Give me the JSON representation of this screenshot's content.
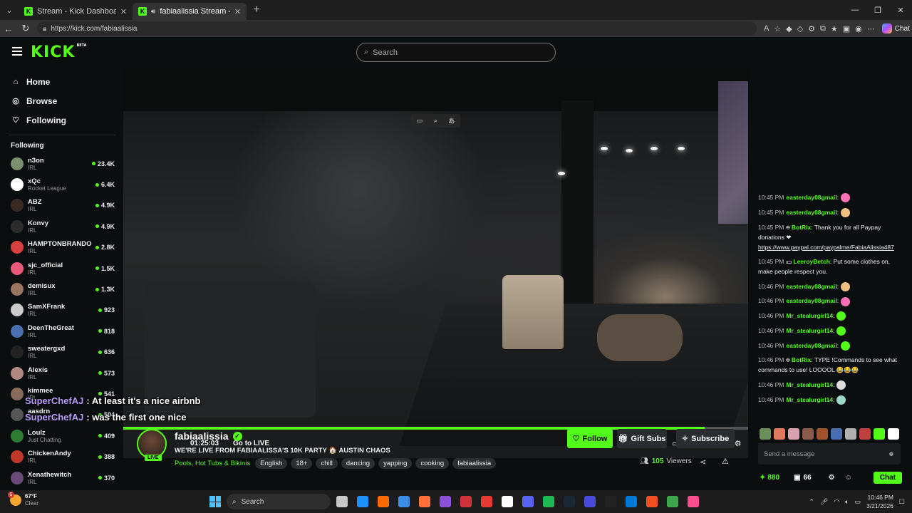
{
  "browser": {
    "tabs": [
      {
        "title": "Stream - Kick Dashboard",
        "active": false
      },
      {
        "title": "fabiaalissia Stream - Watch Li",
        "active": true
      }
    ],
    "url": "https://kick.com/fabiaalissia",
    "copilot_label": "Chat"
  },
  "header": {
    "logo": "KICK",
    "logo_badge": "BETA",
    "search_placeholder": "Search"
  },
  "sidebar": {
    "nav": [
      {
        "label": "Home",
        "icon": "home-icon"
      },
      {
        "label": "Browse",
        "icon": "compass-icon"
      },
      {
        "label": "Following",
        "icon": "heart-icon"
      }
    ],
    "following_title": "Following",
    "channels": [
      {
        "name": "n3on",
        "category": "IRL",
        "viewers": "23.4K",
        "color": "#7a8f6e"
      },
      {
        "name": "xQc",
        "category": "Rocket League",
        "viewers": "6.4K",
        "color": "#ffffff"
      },
      {
        "name": "ABZ",
        "category": "IRL",
        "viewers": "4.9K",
        "color": "#3a2b22"
      },
      {
        "name": "Konvy",
        "category": "IRL",
        "viewers": "4.9K",
        "color": "#2c2c2c"
      },
      {
        "name": "HAMPTONBRANDO",
        "category": "IRL",
        "viewers": "2.8K",
        "color": "#d64040"
      },
      {
        "name": "sjc_official",
        "category": "IRL",
        "viewers": "1.5K",
        "color": "#e85a7a"
      },
      {
        "name": "demisux",
        "category": "IRL",
        "viewers": "1.3K",
        "color": "#9a7560"
      },
      {
        "name": "SamXFrank",
        "category": "IRL",
        "viewers": "923",
        "color": "#cccccc"
      },
      {
        "name": "DeenTheGreat",
        "category": "IRL",
        "viewers": "818",
        "color": "#4a6fb0"
      },
      {
        "name": "sweatergxd",
        "category": "IRL",
        "viewers": "636",
        "color": "#222222"
      },
      {
        "name": "Alexis",
        "category": "IRL",
        "viewers": "573",
        "color": "#b08a80"
      },
      {
        "name": "kimmee",
        "category": "IRL",
        "viewers": "541",
        "color": "#8a6a5a"
      },
      {
        "name": "aasdrn",
        "category": "Counter-Strike 2",
        "viewers": "504",
        "color": "#555555"
      },
      {
        "name": "Loulz",
        "category": "Just Chatting",
        "viewers": "409",
        "color": "#2e7d32"
      },
      {
        "name": "ChickenAndy",
        "category": "IRL",
        "viewers": "388",
        "color": "#c0392b"
      },
      {
        "name": "Xenathewitch",
        "category": "IRL",
        "viewers": "370",
        "color": "#6b4a7a"
      }
    ]
  },
  "player": {
    "time": "01:25:03",
    "go_live": "Go to LIVE",
    "progress": 0.93,
    "captions": [
      {
        "user": "SuperChefAJ",
        "text": ": At least it's a nice airbnb"
      },
      {
        "user": "SuperChefAJ",
        "text": ": was the first one nice"
      }
    ]
  },
  "stream": {
    "streamer": "fabiaalissia",
    "live_label": "LIVE",
    "title": "WE'RE LIVE FROM FABIAALISSA'S 10K PARTY 🏠 AUSTIN CHAOS",
    "category": "Pools, Hot Tubs & Bikinis",
    "tags": [
      "English",
      "18+",
      "chill",
      "dancing",
      "yapping",
      "cooking",
      "fabiaalissia"
    ],
    "viewers_count": "105",
    "viewers_label": "Viewers",
    "follow_label": "Follow",
    "gift_label": "Gift Subs",
    "subscribe_label": "Subscribe"
  },
  "chat": {
    "messages": [
      {
        "time": "10:45 PM",
        "user": "easterday08gmail",
        "color": "#53fc18",
        "text": ":",
        "emote": "#ff6fb5"
      },
      {
        "time": "10:45 PM",
        "user": "easterday08gmail",
        "color": "#53fc18",
        "text": ":",
        "emote": "#f0c080"
      },
      {
        "time": "10:45 PM",
        "user": "BotRix",
        "color": "#53fc18",
        "text": ": Thank you for all Paypay donations ❤",
        "link": "https://www.paypal.com/paypalme/FabiaAlissia487"
      },
      {
        "time": "10:45 PM",
        "user": "LeeroyBetch",
        "color": "#53fc18",
        "text": ": Put some clothes on, make people respect you."
      },
      {
        "time": "10:46 PM",
        "user": "easterday08gmail",
        "color": "#53fc18",
        "text": ":",
        "emote": "#f0c080"
      },
      {
        "time": "10:46 PM",
        "user": "easterday08gmail",
        "color": "#53fc18",
        "text": ":",
        "emote": "#ff6fb5"
      },
      {
        "time": "10:46 PM",
        "user": "Mr_stealurgirl14",
        "color": "#53fc18",
        "text": ":",
        "emote": "#53fc18"
      },
      {
        "time": "10:46 PM",
        "user": "Mr_stealurgirl14",
        "color": "#53fc18",
        "text": ":",
        "emote": "#53fc18"
      },
      {
        "time": "10:46 PM",
        "user": "easterday08gmail",
        "color": "#53fc18",
        "text": ":",
        "emote": "#53fc18"
      },
      {
        "time": "10:46 PM",
        "user": "BotRix",
        "color": "#53fc18",
        "text": ": TYPE !Commands to see what commands to use! LOOOOL 😂😂😂"
      },
      {
        "time": "10:46 PM",
        "user": "Mr_stealurgirl14",
        "color": "#53fc18",
        "text": ":",
        "emote": "#dddddd"
      },
      {
        "time": "10:46 PM",
        "user": "Mr_stealurgirl14",
        "color": "#53fc18",
        "text": ":",
        "emote": "#9fd8c8"
      }
    ],
    "emote_colors": [
      "#6b8f5a",
      "#e07a5f",
      "#d9a0b0",
      "#8a5a4a",
      "#a0522d",
      "#4a6fb0",
      "#b0b0b0",
      "#c04040",
      "#53fc18",
      "#ffffff"
    ],
    "input_placeholder": "Send a message",
    "points": "880",
    "gifts": "66",
    "chat_button": "Chat"
  },
  "taskbar": {
    "weather_temp": "67°F",
    "weather_desc": "Clear",
    "weather_badge": "5",
    "search_label": "Search",
    "time": "10:46 PM",
    "date": "3/21/2026",
    "app_colors": [
      "#c9c9c9",
      "#1e90ff",
      "#ff6a00",
      "#3a8ee6",
      "#ff7139",
      "#8b4fd8",
      "#d13438",
      "#e53935",
      "#ffffff",
      "#5865f2",
      "#1db954",
      "#1b2838",
      "#4a4ad8",
      "#222222",
      "#0078d4",
      "#f25022",
      "#3da64a",
      "#ff4d8d"
    ]
  }
}
